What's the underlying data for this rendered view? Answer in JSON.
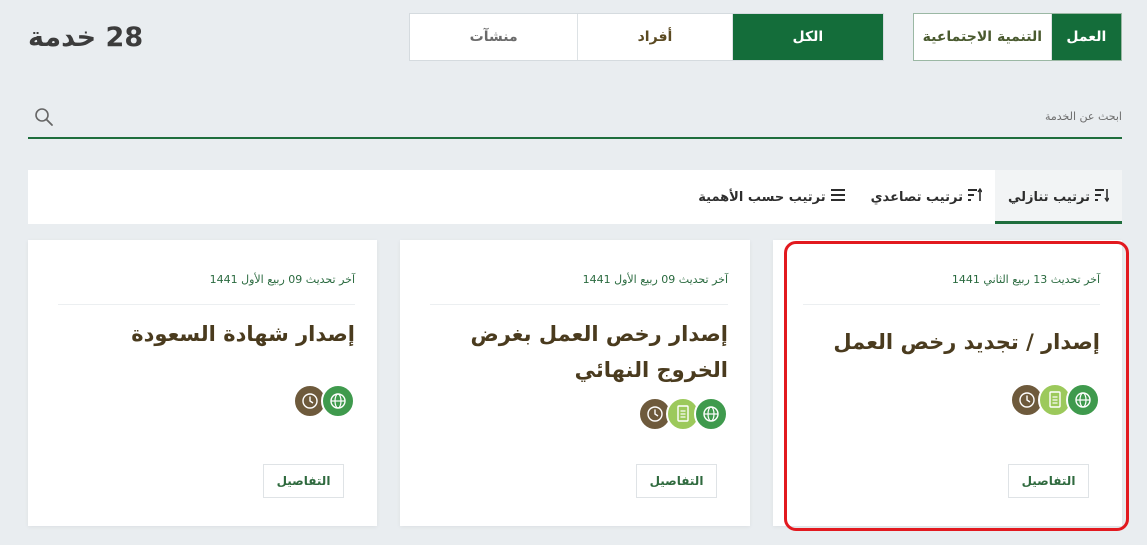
{
  "header": {
    "service_count": "28 خدمة"
  },
  "category_tabs": [
    {
      "label": "العمل",
      "active": true
    },
    {
      "label": "التنمية الاجتماعية",
      "active": false
    }
  ],
  "audience_tabs": [
    {
      "label": "الكل",
      "active": true
    },
    {
      "label": "أفراد",
      "active": false
    },
    {
      "label": "منشآت",
      "active": false
    }
  ],
  "search": {
    "placeholder": "ابحث عن الخدمة",
    "icon": "search-icon"
  },
  "sort": [
    {
      "label": "ترتيب تنازلي",
      "active": true,
      "icon": "sort-descending-icon"
    },
    {
      "label": "ترتيب تصاعدي",
      "active": false,
      "icon": "sort-ascending-icon"
    },
    {
      "label": "ترتيب حسب الأهمية",
      "active": false,
      "icon": "list-icon"
    }
  ],
  "cards": [
    {
      "date": "آخر تحديث 13 ربيع الثاني 1441",
      "title": "إصدار / تجديد رخص العمل",
      "details_label": "التفاصيل",
      "icons": [
        "globe-icon",
        "document-icon",
        "clock-icon"
      ]
    },
    {
      "date": "آخر تحديث 09 ربيع الأول 1441",
      "title": "إصدار رخص العمل بغرض الخروج النهائي",
      "details_label": "التفاصيل",
      "icons": [
        "globe-icon",
        "document-icon",
        "clock-icon"
      ]
    },
    {
      "date": "آخر تحديث 09 ربيع الأول 1441",
      "title": "إصدار شهادة السعودة",
      "details_label": "التفاصيل",
      "icons": [
        "globe-icon",
        "clock-icon"
      ]
    }
  ],
  "colors": {
    "primary_green": "#146d3a",
    "highlight": "#e2191f",
    "title_brown": "#4a3b1e"
  }
}
